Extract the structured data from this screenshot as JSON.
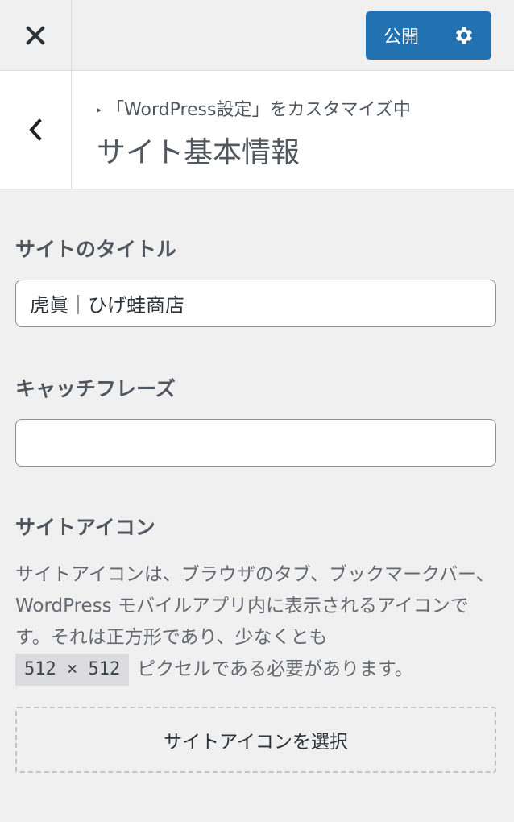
{
  "header": {
    "close_icon": "close-icon",
    "publish_label": "公開",
    "settings_icon": "gear-icon",
    "accent_color": "#2271b1"
  },
  "section": {
    "meta_prefix": "「WordPress設定」をカスタマイズ中",
    "title": "サイト基本情報",
    "back_icon": "chevron-left-icon"
  },
  "site_title": {
    "label": "サイトのタイトル",
    "value": "虎眞｜ひげ蛙商店"
  },
  "tagline": {
    "label": "キャッチフレーズ",
    "value": ""
  },
  "site_icon": {
    "label": "サイトアイコン",
    "description_part1": "サイトアイコンは、ブラウザのタブ、ブックマークバー、WordPress モバイルアプリ内に表示されるアイコンです。それは正方形であり、少なくとも",
    "size_chip": "512 × 512",
    "description_part2": "ピクセルである必要があります。",
    "select_button": "サイトアイコンを選択"
  }
}
